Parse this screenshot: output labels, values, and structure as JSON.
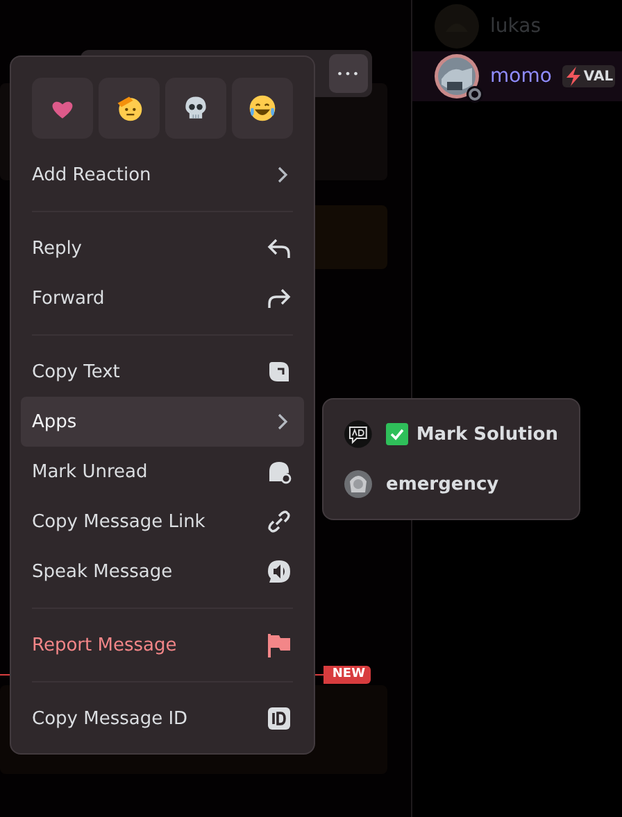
{
  "chat": {
    "new_messages_divider": {
      "badge": "NEW"
    }
  },
  "message_toolbar": {
    "more_button": {
      "label": "•••",
      "selected": true
    }
  },
  "context_menu": {
    "quick_reactions": [
      {
        "kind": "heart"
      },
      {
        "kind": "salute"
      },
      {
        "kind": "skull"
      },
      {
        "kind": "laugh"
      }
    ],
    "sections": [
      {
        "items": [
          {
            "label": "Add Reaction",
            "kind": "submenu",
            "selected": false,
            "danger": false
          }
        ]
      },
      {
        "items": [
          {
            "label": "Reply",
            "kind": "reply",
            "selected": false,
            "danger": false
          },
          {
            "label": "Forward",
            "kind": "forward",
            "selected": false,
            "danger": false
          }
        ]
      },
      {
        "items": [
          {
            "label": "Copy Text",
            "kind": "copy",
            "selected": false,
            "danger": false
          },
          {
            "label": "Apps",
            "kind": "submenu",
            "selected": true,
            "danger": false
          },
          {
            "label": "Mark Unread",
            "kind": "unread",
            "selected": false,
            "danger": false
          },
          {
            "label": "Copy Message Link",
            "kind": "link",
            "selected": false,
            "danger": false
          },
          {
            "label": "Speak Message",
            "kind": "speak",
            "selected": false,
            "danger": false
          }
        ]
      },
      {
        "items": [
          {
            "label": "Report Message",
            "kind": "flag",
            "selected": false,
            "danger": true
          }
        ]
      },
      {
        "items": [
          {
            "label": "Copy Message ID",
            "kind": "id",
            "selected": false,
            "danger": false
          }
        ]
      }
    ]
  },
  "apps_submenu": {
    "items": [
      {
        "label": "Mark Solution",
        "kind": "bot",
        "checked": true
      },
      {
        "label": "emergency",
        "kind": "user",
        "checked": false
      }
    ]
  },
  "members": [
    {
      "name": "lukas",
      "offline": true,
      "selected": false,
      "status_indicator": false
    },
    {
      "name": "momo",
      "offline": false,
      "selected": true,
      "status_indicator": true,
      "badge": "VAL"
    }
  ]
}
